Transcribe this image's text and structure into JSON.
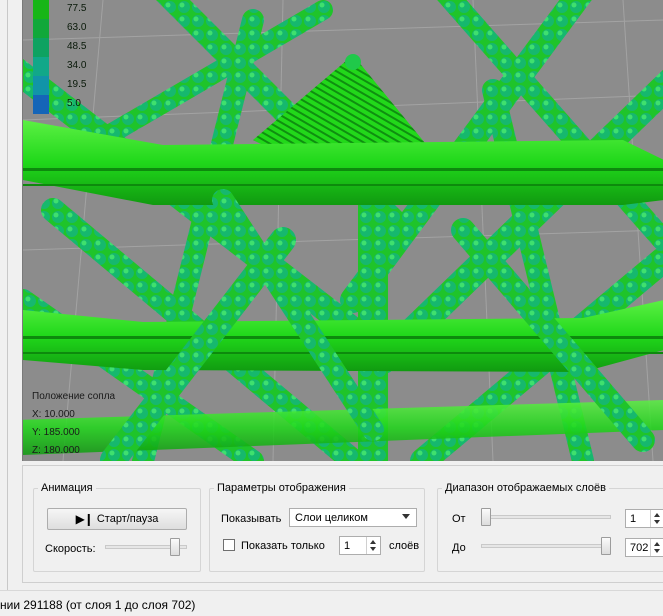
{
  "legend": {
    "items": [
      {
        "label": "77.5",
        "color": "#17b617"
      },
      {
        "label": "63.0",
        "color": "#11a83a"
      },
      {
        "label": "48.5",
        "color": "#0ea261"
      },
      {
        "label": "34.0",
        "color": "#11a889"
      },
      {
        "label": "19.5",
        "color": "#1194a8"
      },
      {
        "label": "5.0",
        "color": "#1565b8"
      }
    ]
  },
  "nozzle": {
    "title": "Положение сопла",
    "x": "X: 10.000",
    "y": "Y: 185.000",
    "z": "Z: 180.000"
  },
  "animation": {
    "title": "Анимация",
    "start_pause_label": "Старт/пауза",
    "speed_label": "Скорость:",
    "speed_level": 0.9
  },
  "display": {
    "title": "Параметры отображения",
    "show_label": "Показывать",
    "show_value": "Слои целиком",
    "only_label": "Показать только",
    "only_value": "1",
    "layers_suffix": "слоёв"
  },
  "range": {
    "title": "Диапазон отображаемых слоёв",
    "from_label": "От",
    "from_value": "1",
    "to_label": "До",
    "to_value": "702"
  },
  "status": {
    "text": "нии 291188 (от слоя 1 до слоя 702)"
  },
  "colors": {
    "bright_green": "#22e01a",
    "teal_green": "#12b86a",
    "bed_gray": "#8a8a8a"
  }
}
